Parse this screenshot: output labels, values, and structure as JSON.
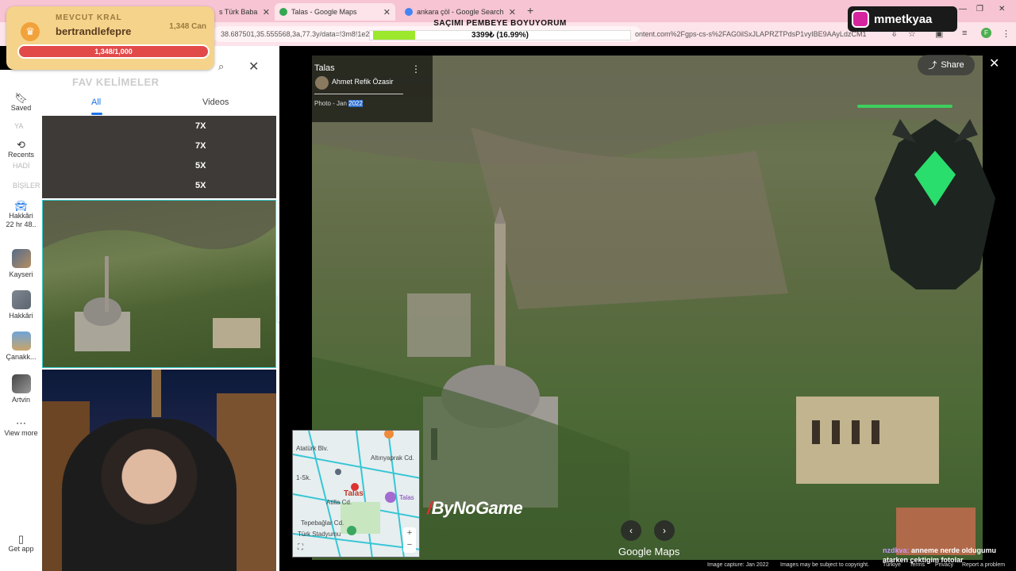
{
  "browser": {
    "tabs": [
      {
        "label": "s Türk Baba",
        "active": false
      },
      {
        "label": "Talas - Google Maps",
        "active": true
      },
      {
        "label": "ankara çöl - Google Search",
        "active": false
      }
    ],
    "url_left": "38.687501,35.555568,3a,77.3y/data=!3m8!1e2!3m6!1sCIHM0",
    "url_right": "ontent.com%2Fgps-cs-s%2FAG0ilSxJLAPRZTPdsP1vyIBE9AAyLdzCM1"
  },
  "overlay": {
    "kral_label": "MEVCUT KRAL",
    "kral_name": "bertrandlefepre",
    "kral_amount": "1,348 Can",
    "kral_progress_text": "1,348/1,000",
    "goal_title": "SAÇIMI PEMBEYE BOYUYORUM",
    "goal_value": "3399₺ (16.99%)",
    "goal_fraction": 0.1699,
    "instagram_handle": "mmetkyaa"
  },
  "rail": {
    "saved": "Saved",
    "recents": "Recents",
    "hakkari_recent": "Hakkâri",
    "hakkari_sub": "22 hr 48..",
    "kayseri": "Kayseri",
    "hakkari": "Hakkâri",
    "canakkale": "Çanakk...",
    "artvin": "Artvin",
    "view_more": "View more",
    "get_app": "Get app",
    "ghost_ya": "YA",
    "ghost_hadi": "HADİ",
    "ghost_bisiler": "BİŞİLER"
  },
  "panel": {
    "fav_kelimeler": "FAV KELİMELER",
    "tab_all": "All",
    "tab_videos": "Videos",
    "multipliers": [
      "7X",
      "7X",
      "5X",
      "5X"
    ]
  },
  "photo": {
    "place": "Talas",
    "author": "Ahmet Refik Özasir",
    "date_prefix": "Photo - Jan ",
    "date_year": "2022",
    "share_label": "Share",
    "watermark": "ByNoGame",
    "google_maps": "Google Maps",
    "minimap": {
      "label_main": "Talas",
      "label_poi": "Talas",
      "street1": "Atatürk Blv.",
      "street2": "Altınyaprak Cd.",
      "street3": "1-Sk.",
      "street4": "Tepebağlar Cd.",
      "street5": "Türk Stadyumu",
      "street6": "Atilla Cd."
    },
    "footer": {
      "capture": "Image capture: Jan 2022",
      "copyright": "Images may be subject to copyright.",
      "country": "Türkiye",
      "terms": "Terms",
      "privacy": "Privacy",
      "report": "Report a problem"
    }
  },
  "chat": {
    "user": "nzdkva:",
    "message": "anneme nerde oldugumu atarken çektigim fotolar"
  },
  "colors": {
    "tabstrip": "#f6c4d3",
    "accent_blue": "#1a73e8",
    "goal_fill": "#9ce82c",
    "kral_bg": "#f5d38a"
  }
}
